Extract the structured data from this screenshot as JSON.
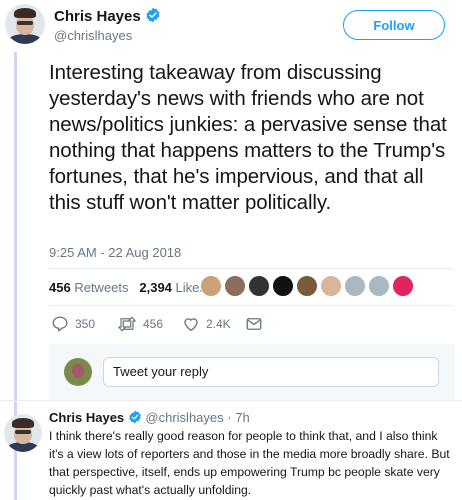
{
  "tweet": {
    "author_name": "Chris Hayes",
    "author_handle": "@chrislhayes",
    "follow_label": "Follow",
    "text": "Interesting takeaway from discussing yesterday's news with friends who are not news/politics junkies: a pervasive sense that nothing that happens matters to the Trump's fortunes, that he's impervious, and that all this stuff won't matter politically.",
    "timestamp": "9:25 AM - 22 Aug 2018",
    "retweets_count": "456",
    "retweets_label": "Retweets",
    "likes_count": "2,394",
    "likes_label": "Likes",
    "actions": {
      "reply_count": "350",
      "retweet_count": "456",
      "like_count": "2.4K"
    }
  },
  "reply_box": {
    "placeholder": "Tweet your reply"
  },
  "reply": {
    "author_name": "Chris Hayes",
    "author_handle": "@chrislhayes",
    "time": "7h",
    "text": "I think there's really good reason for people to think that, and I also think it's a view lots of reporters and those in the media more broadly share. But that perspective, itself, ends up empowering Trump bc people skate very quickly past what's actually unfolding."
  },
  "colors": {
    "accent": "#1da1f2",
    "thread_line": "#cfd6f5",
    "muted": "#657786"
  },
  "icons": [
    "verified-icon",
    "reply-icon",
    "retweet-icon",
    "like-icon",
    "direct-message-icon"
  ]
}
